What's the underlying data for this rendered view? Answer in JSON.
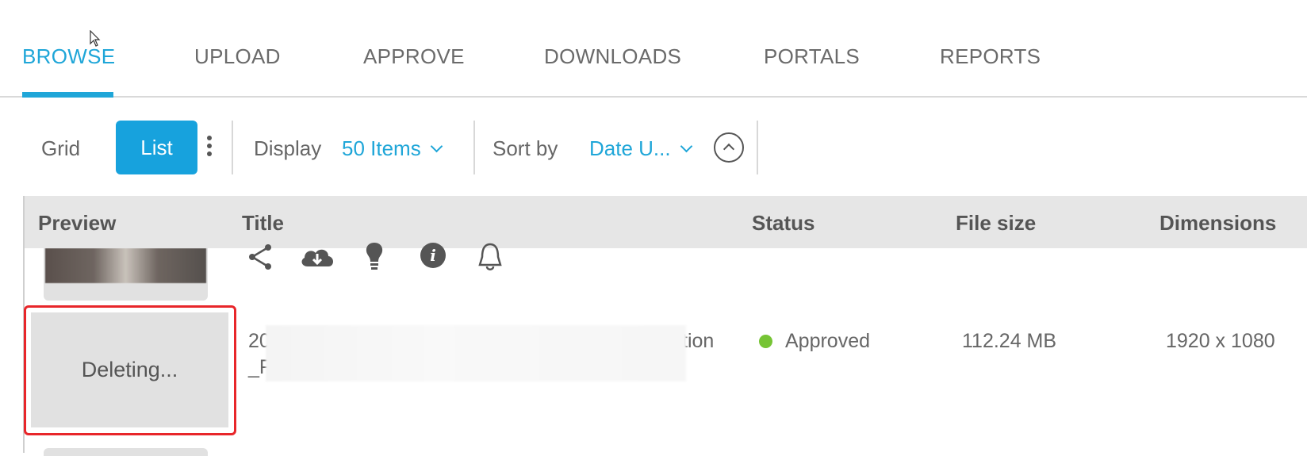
{
  "nav": {
    "tabs": [
      {
        "label": "BROWSE",
        "active": true
      },
      {
        "label": "UPLOAD",
        "active": false
      },
      {
        "label": "APPROVE",
        "active": false
      },
      {
        "label": "DOWNLOADS",
        "active": false
      },
      {
        "label": "PORTALS",
        "active": false
      },
      {
        "label": "REPORTS",
        "active": false
      }
    ]
  },
  "toolbar": {
    "grid_label": "Grid",
    "list_label": "List",
    "display_label": "Display",
    "display_value": "50 Items",
    "sort_label": "Sort by",
    "sort_value": "Date U..."
  },
  "table": {
    "columns": [
      "Preview",
      "Title",
      "Status",
      "File size",
      "Dimensions"
    ],
    "action_icons": [
      "share-icon",
      "download-icon",
      "lightbulb-icon",
      "info-icon",
      "bell-icon"
    ],
    "deleting_row": {
      "preview_text": "Deleting...",
      "title_line1_start": "20",
      "title_line1_end": "tion",
      "title_line2_start": "_F",
      "status": "Approved",
      "file_size": "112.24 MB",
      "dimensions": "1920 x 1080"
    }
  },
  "colors": {
    "accent": "#1fa6d8",
    "approved": "#76c435",
    "highlight": "#e8262a"
  }
}
